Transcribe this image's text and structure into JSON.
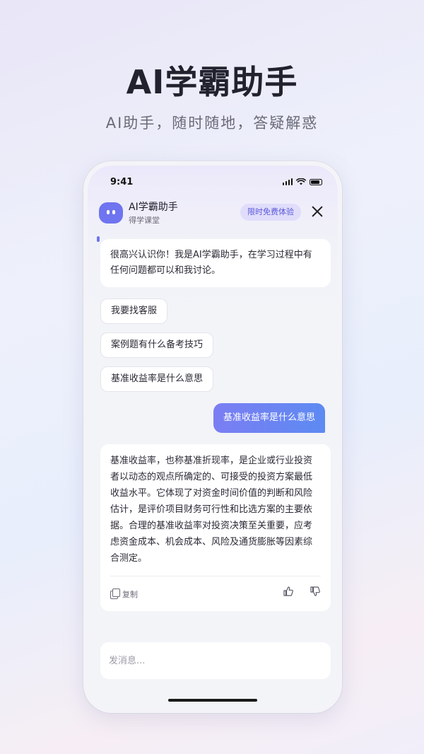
{
  "hero": {
    "title": "AI学霸助手",
    "subtitle": "AI助手，随时随地，答疑解惑"
  },
  "status_bar": {
    "time": "9:41"
  },
  "chat_header": {
    "bot_name": "AI学霸助手",
    "bot_subtitle": "得学课堂",
    "promo_badge": "限时免费体验"
  },
  "messages": {
    "greeting": "很高兴认识你！我是AI学霸助手，在学习过程中有任何问题都可以和我讨论。",
    "suggestions": [
      "我要找客服",
      "案例题有什么备考技巧",
      "基准收益率是什么意思"
    ],
    "user_message": "基准收益率是什么意思",
    "answer": "基准收益率，也称基准折现率，是企业或行业投资者以动态的观点所确定的、可接受的投资方案最低收益水平。它体现了对资金时间价值的判断和风险估计，是评价项目财务可行性和比选方案的主要依据。合理的基准收益率对投资决策至关重要，应考虑资金成本、机会成本、风险及通货膨胀等因素综合测定。",
    "copy_label": "复制"
  },
  "input": {
    "placeholder": "发消息..."
  },
  "colors": {
    "accent": "#6f74f0",
    "user_bubble_start": "#7b7ef3",
    "user_bubble_end": "#5d8af2",
    "badge_bg": "#e0ddfb"
  }
}
